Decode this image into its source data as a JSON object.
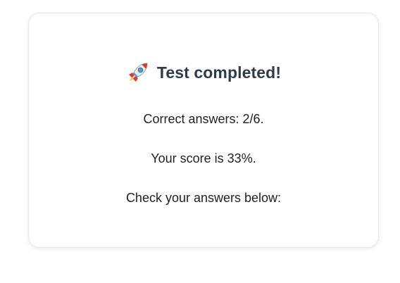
{
  "result": {
    "title": "Test completed!",
    "icon": "rocket-icon",
    "correct_answers": "Correct answers: 2/6.",
    "score": "Your score is 33%.",
    "check": "Check your answers below:"
  }
}
